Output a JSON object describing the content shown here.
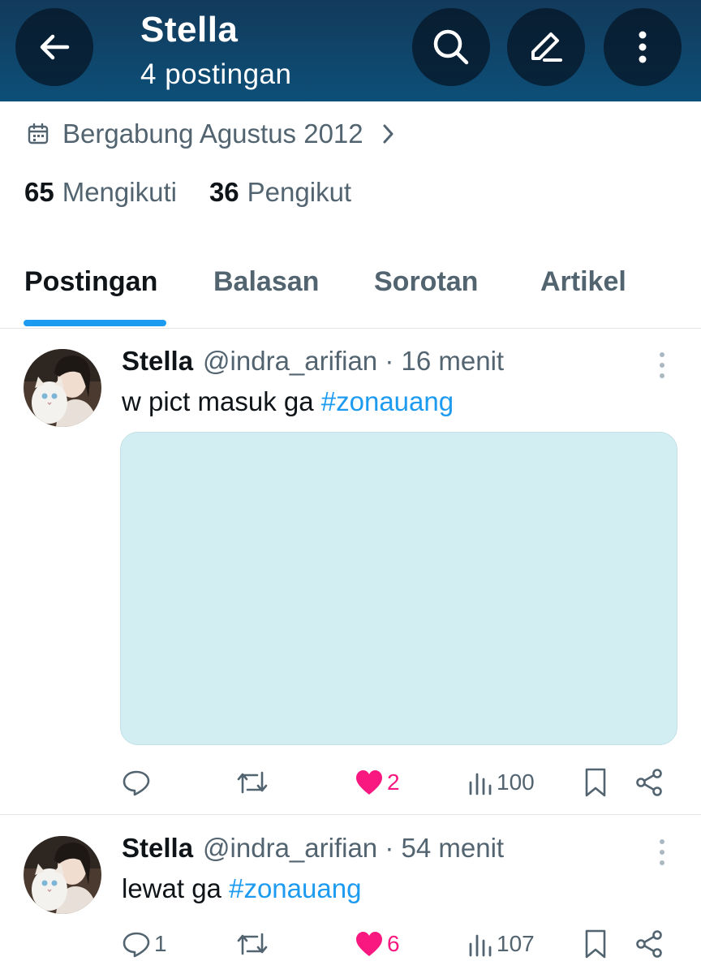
{
  "header": {
    "title": "Stella",
    "subtitle": "4 postingan"
  },
  "profile": {
    "joined": "Bergabung Agustus 2012",
    "following_count": "65",
    "following_label": "Mengikuti",
    "followers_count": "36",
    "followers_label": "Pengikut"
  },
  "tabs": [
    {
      "label": "Postingan",
      "active": true
    },
    {
      "label": "Balasan",
      "active": false
    },
    {
      "label": "Sorotan",
      "active": false
    },
    {
      "label": "Artikel",
      "active": false
    }
  ],
  "posts": [
    {
      "name": "Stella",
      "handle": "@indra_arifian",
      "time": "· 16 menit",
      "text": "w pict masuk ga ",
      "hashtag": "#zonauang",
      "replies": "",
      "likes": "2",
      "views": "100"
    },
    {
      "name": "Stella",
      "handle": "@indra_arifian",
      "time": "· 54 menit",
      "text": "lewat ga ",
      "hashtag": "#zonauang",
      "replies": "1",
      "likes": "6",
      "views": "107"
    }
  ],
  "colors": {
    "accent": "#1d9bf0",
    "like": "#f91880",
    "header": "#0d4f78",
    "media_placeholder": "#d2eef3"
  }
}
